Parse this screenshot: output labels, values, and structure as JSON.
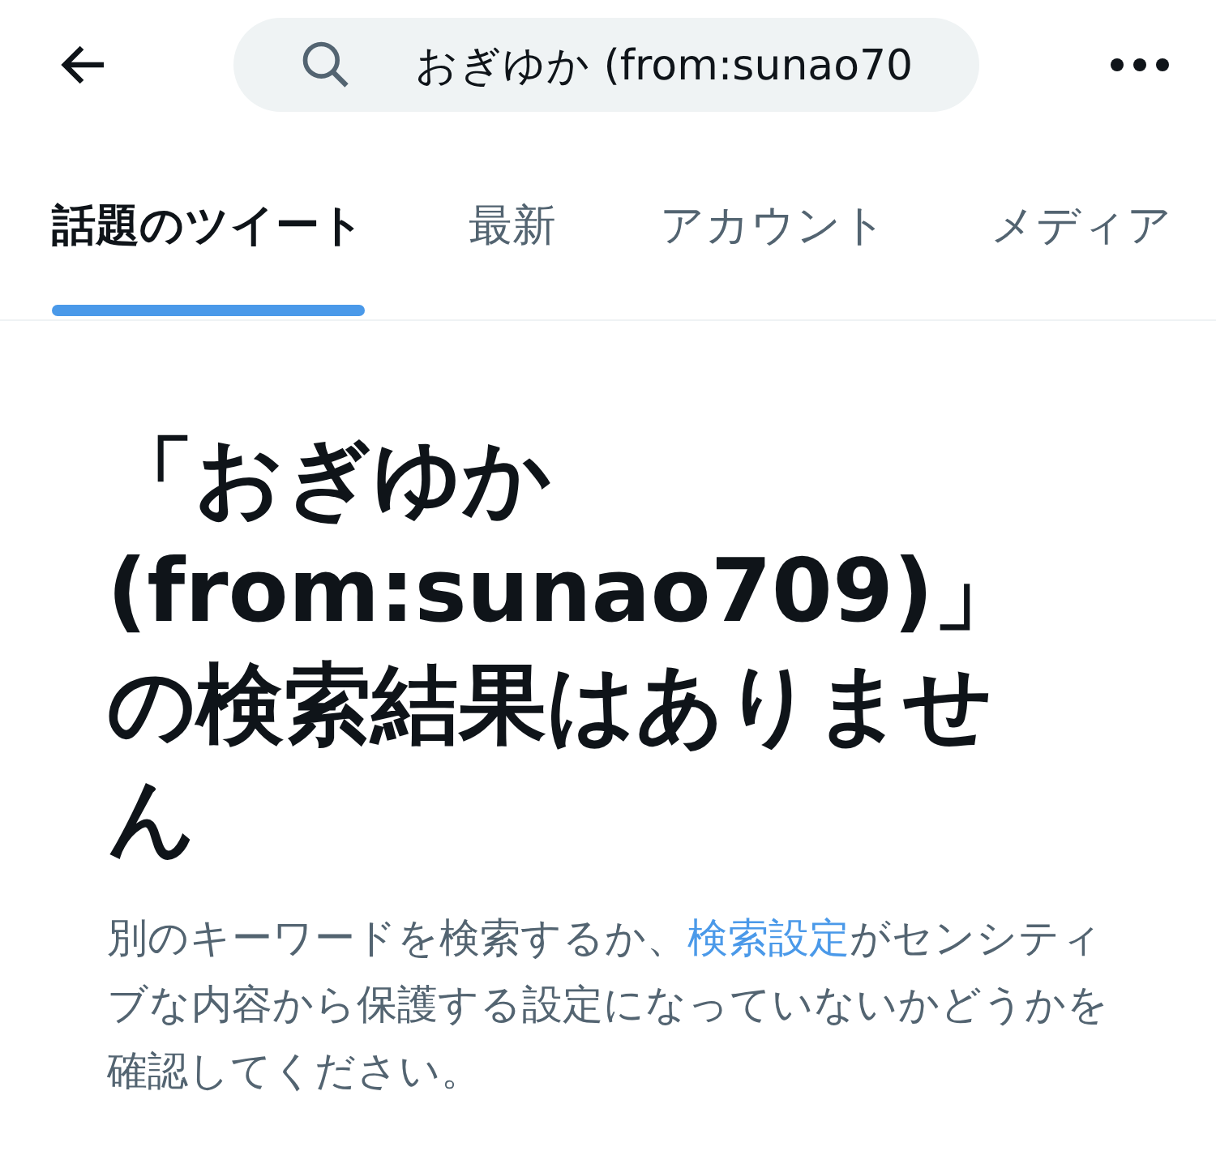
{
  "search": {
    "value": "おぎゆか (from:sunao70"
  },
  "tabs": [
    {
      "label": "話題のツイート",
      "selected": true
    },
    {
      "label": "最新",
      "selected": false
    },
    {
      "label": "アカウント",
      "selected": false
    },
    {
      "label": "メディア",
      "selected": false
    }
  ],
  "empty_state": {
    "title": "「おぎゆか (from:sunao709)」の検索結果はありません",
    "message_before": "別のキーワードを検索するか、",
    "message_link": "検索設定",
    "message_after": "がセンシティブな内容から保護する設定になっていないかどうかを確認してください。"
  }
}
